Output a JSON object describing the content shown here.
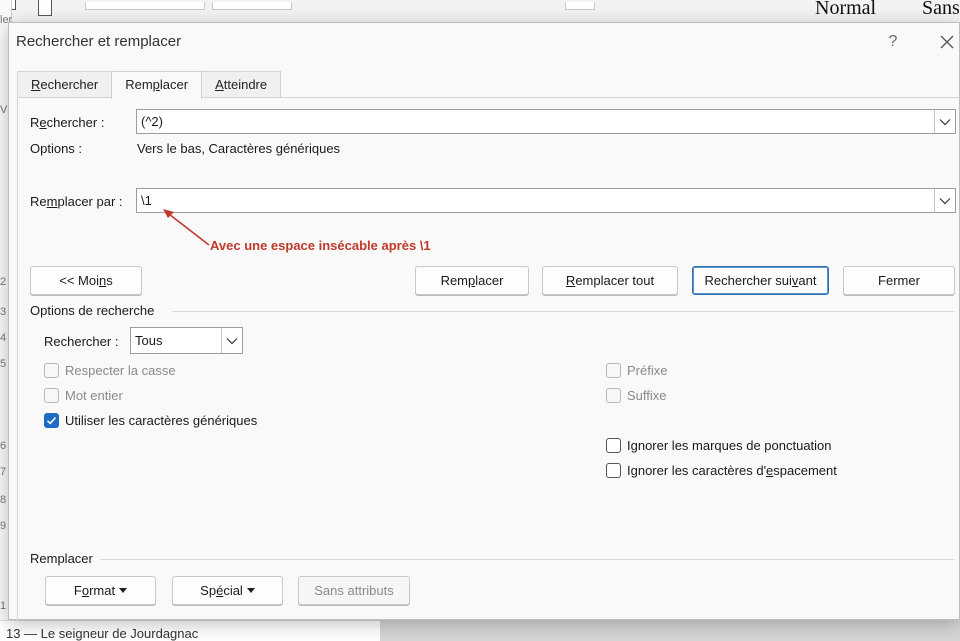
{
  "background": {
    "style_normal": "Normal",
    "style_sans": "Sans",
    "nav_item": "13 — Le seigneur de Jourdagnac",
    "side_glyphs": [
      "ler",
      "V",
      "2",
      "3",
      "4",
      "5",
      "6",
      "7",
      "8",
      "9",
      "1"
    ]
  },
  "dialog": {
    "title": "Rechercher et remplacer",
    "help_label": "?",
    "tabs": [
      {
        "label": "Rechercher",
        "access_key": "R"
      },
      {
        "label": "Remplacer",
        "access_key": "p"
      },
      {
        "label": "Atteindre",
        "access_key": "A"
      }
    ],
    "find": {
      "label_pre": "R",
      "label_key": "e",
      "label_post": "chercher :",
      "value": "(^2)"
    },
    "options": {
      "label": "Options :",
      "value": "Vers le bas, Caractères génériques"
    },
    "replace": {
      "label_pre": "Re",
      "label_key": "m",
      "label_post": "placer par :",
      "value": "\\1"
    },
    "annotation": "Avec une espace insécable après \\1",
    "buttons": {
      "less_pre": "<< Moi",
      "less_key": "n",
      "less_post": "s",
      "replace_pre": "Rem",
      "replace_key": "p",
      "replace_post": "lacer",
      "replace_all_pre": "",
      "replace_all_key": "R",
      "replace_all_post": "emplacer tout",
      "find_next_pre": "Rechercher sui",
      "find_next_key": "v",
      "find_next_post": "ant",
      "close": "Fermer"
    },
    "search_options": {
      "title": "Options de recherche",
      "direction_label_pre": "Rechercher",
      "direction_label_key": "",
      "direction_label_post": " :",
      "direction_value": "Tous",
      "checkboxes_left": [
        {
          "label": "Respecter la casse",
          "checked": false,
          "enabled": false
        },
        {
          "label": "Mot entier",
          "checked": false,
          "enabled": false
        },
        {
          "label_pre": "Utiliser les caractères ",
          "label_key": "g",
          "label_post": "énériques",
          "checked": true,
          "enabled": true
        }
      ],
      "checkboxes_right": [
        {
          "label": "Préfixe",
          "checked": false,
          "enabled": false
        },
        {
          "label": "Suffixe",
          "checked": false,
          "enabled": false
        },
        {
          "label": "Ignorer les marques de ponctuation",
          "checked": false,
          "enabled": true
        },
        {
          "label_pre": "Ignorer les caractères d'",
          "label_key": "e",
          "label_post": "spacement",
          "checked": false,
          "enabled": true
        }
      ]
    },
    "replace_section": {
      "title": "Remplacer",
      "format_pre": "F",
      "format_key": "o",
      "format_post": "rmat",
      "special_pre": "Sp",
      "special_key": "é",
      "special_post": "cial",
      "no_format": "Sans attributs"
    },
    "colors": {
      "accent": "#1a6dc2",
      "annotation": "#c0392b"
    }
  }
}
